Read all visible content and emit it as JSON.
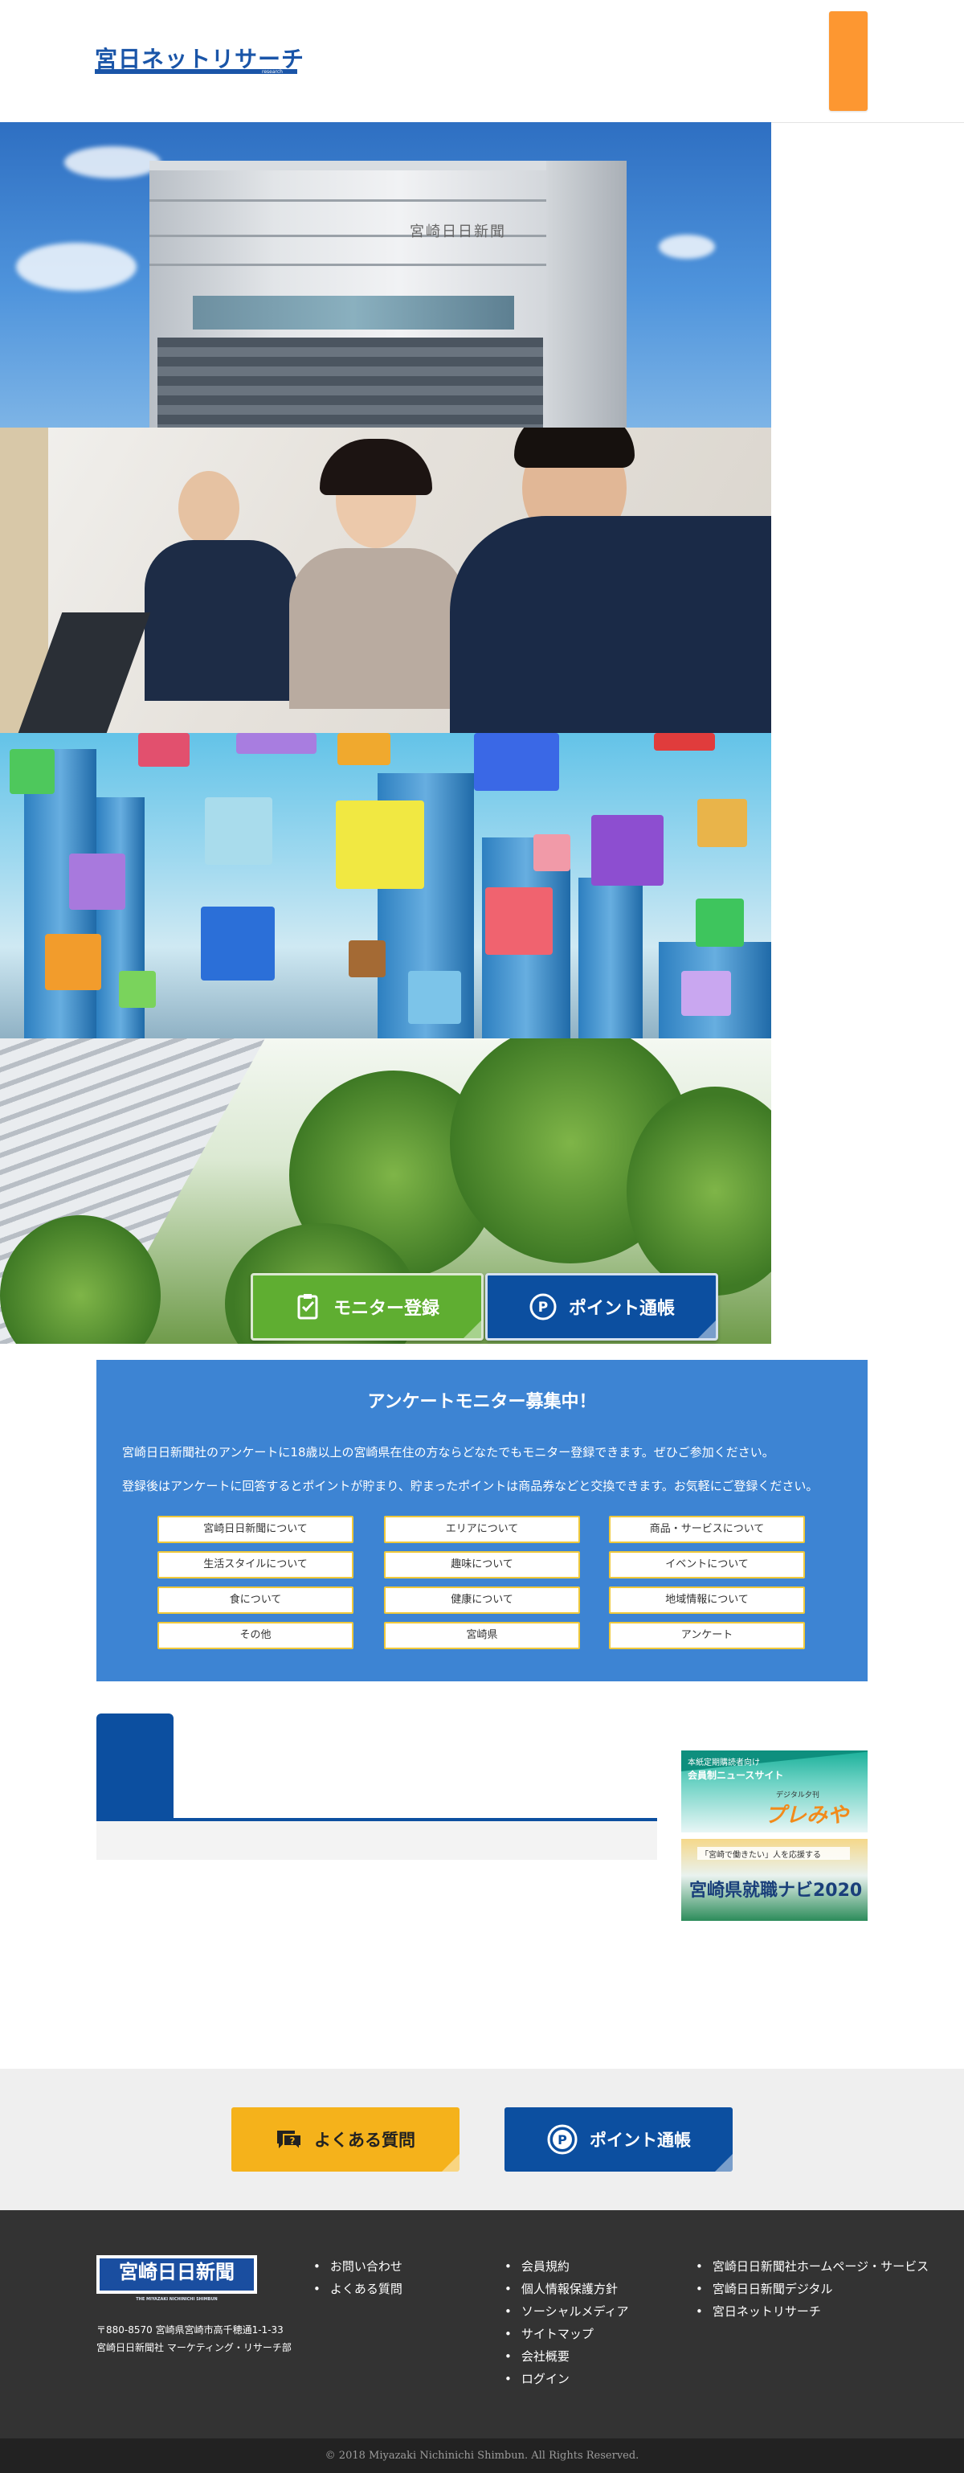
{
  "header": {
    "logo_text": "宮日ネットリサーチ",
    "logo_sub": "research",
    "menu_button": ""
  },
  "hero": {
    "building_sign": "宮崎日日新聞",
    "buttons": {
      "monitor": "モニター登録",
      "point": "ポイント通帳"
    }
  },
  "info": {
    "title": "アンケートモニター募集中！",
    "line1": "宮崎日日新聞社のアンケートに18歳以上の宮崎県在住の方ならどなたでもモニター登録できます。ぜひご参加ください。",
    "line2": "登録後はアンケートに回答するとポイントが貯まり、貯まったポイントは商品券などと交換できます。お気軽にご登録ください。",
    "categories": [
      "宮崎日日新聞について",
      "エリアについて",
      "商品・サービスについて",
      "生活スタイルについて",
      "趣味について",
      "イベントについて",
      "食について",
      "健康について",
      "地域情報について",
      "その他",
      "宮崎県",
      "アンケート"
    ]
  },
  "sidebar": {
    "banner1_line1": "本紙定期購読者向け",
    "banner1_line2": "会員制ニュースサイト",
    "banner1_line3": "デジタル夕刊",
    "banner1_title": "プレみや",
    "banner2_line1": "「宮崎で働きたい」人を応援する",
    "banner2_title": "宮崎県就職ナビ2020"
  },
  "lower": {
    "faq": "よくある質問",
    "point": "ポイント通帳"
  },
  "footer": {
    "logo": "宮崎日日新聞",
    "logo_sub": "THE MIYAZAKI NICHINICHI SHIMBUN",
    "addr1": "〒880-8570 宮崎県宮崎市高千穂通1-1-33",
    "addr2": "宮崎日日新聞社 マーケティング・リサーチ部",
    "col1": [
      "お問い合わせ",
      "よくある質問"
    ],
    "col2": [
      "会員規約",
      "個人情報保護方針",
      "ソーシャルメディア",
      "サイトマップ",
      "会社概要",
      "ログイン"
    ],
    "col3": [
      "宮崎日日新聞社ホームページ・サービス",
      "宮崎日日新聞デジタル",
      "宮日ネットリサーチ"
    ],
    "copyright": "© 2018 Miyazaki Nichinichi Shimbun. All Rights Reserved."
  },
  "colors": {
    "brand_blue": "#0c4fa0",
    "accent_orange": "#fd9731",
    "monitor_green": "#5fae31",
    "info_blue": "#3d84d3",
    "faq_yellow": "#f5b21b"
  }
}
